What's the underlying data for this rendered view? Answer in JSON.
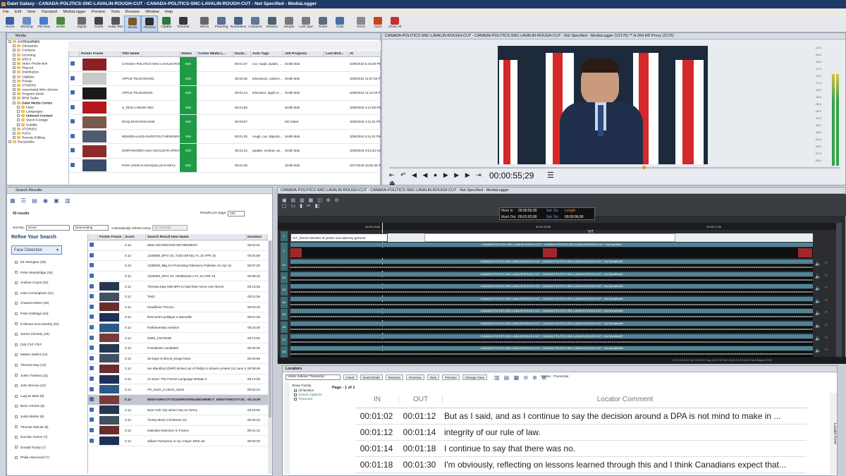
{
  "title": "Dalet Galaxy - CANADA-POLITICS-SNC-LAVALIN-ROUGH-CUT - CANADA-POLITICS-SNC-LAVALIN-ROUGH-CUT - Not Specified - MediaLogger",
  "menu": [
    "File",
    "Edit",
    "View",
    "Transport",
    "MediaLogger",
    "Preview",
    "Tools",
    "Browser",
    "Window",
    "Help"
  ],
  "toolbar": [
    {
      "label": "Home",
      "icon": "home-icon",
      "color": "#3b5ea8"
    },
    {
      "label": "Morning",
      "icon": "morning-icon",
      "color": "#6a8cc7"
    },
    {
      "label": "FB Area",
      "icon": "fb-area-icon",
      "color": "#4a7bc8"
    },
    {
      "label": "SoMe",
      "icon": "some-icon",
      "color": "#4b8a3d"
    },
    {
      "label": "Ingest",
      "icon": "ingest-icon",
      "color": "#6b6b6b"
    },
    {
      "label": "Crash",
      "icon": "crash-icon",
      "color": "#444"
    },
    {
      "label": "Audio Rec",
      "icon": "audio-rec-icon",
      "color": "#555"
    },
    {
      "label": "Media",
      "icon": "media-icon",
      "color": "#7c5a2c"
    },
    {
      "label": "Preview",
      "icon": "preview-icon",
      "color": "#303030"
    },
    {
      "label": "ClipBin",
      "icon": "clipbin-icon",
      "color": "#2b7a3e"
    },
    {
      "label": "Trimmer",
      "icon": "trimmer-icon",
      "color": "#393939"
    },
    {
      "label": "Wires",
      "icon": "wires-icon",
      "color": "#666"
    },
    {
      "label": "Planning",
      "icon": "planning-icon",
      "color": "#5a6f8f"
    },
    {
      "label": "Rundowns",
      "icon": "rundowns-icon",
      "color": "#4a5f80"
    },
    {
      "label": "Contacts",
      "icon": "contacts-icon",
      "color": "#5c7896"
    },
    {
      "label": "Monitor",
      "icon": "monitor-icon",
      "color": "#506070"
    },
    {
      "label": "Simple",
      "icon": "simple-icon",
      "color": "#777"
    },
    {
      "label": "Last Upd",
      "icon": "last-upd-icon",
      "color": "#7a7a7a"
    },
    {
      "label": "Ticker",
      "icon": "ticker-icon",
      "color": "#5d6d80"
    },
    {
      "label": "Chat",
      "icon": "chat-icon",
      "color": "#4a6fa5"
    },
    {
      "label": "OnAir",
      "icon": "onair-icon",
      "color": "#8a8a8a"
    },
    {
      "label": "Carts",
      "icon": "carts-icon",
      "color": "#c8431b"
    },
    {
      "label": "Close All",
      "icon": "close-all-icon",
      "color": "#c53030"
    }
  ],
  "media_panel": {
    "header": "Media",
    "tree": [
      {
        "t": "CATEGORIES",
        "lvl": 0,
        "b": true
      },
      {
        "t": "Glossaries",
        "lvl": 1
      },
      {
        "t": "Contacts",
        "lvl": 1
      },
      {
        "t": "Incoming",
        "lvl": 1
      },
      {
        "t": "NRCS",
        "lvl": 1
      },
      {
        "t": "Video Production",
        "lvl": 1
      },
      {
        "t": "Playout",
        "lvl": 1
      },
      {
        "t": "Distribution",
        "lvl": 1
      },
      {
        "t": "ClipBins",
        "lvl": 1
      },
      {
        "t": "Private",
        "lvl": 1
      },
      {
        "t": "OTHERS",
        "lvl": 1
      },
      {
        "t": "Associated Wire Stories",
        "lvl": 1
      },
      {
        "t": "Program MAM",
        "lvl": 1
      },
      {
        "t": "BPM Tasks",
        "lvl": 1
      },
      {
        "t": "Dalet Media Cortex",
        "lvl": 1,
        "b": true
      },
      {
        "t": "Input",
        "lvl": 2
      },
      {
        "t": "Languages",
        "lvl": 2
      },
      {
        "t": "Indexed Content",
        "lvl": 2,
        "b": true
      },
      {
        "t": "Stock Footage",
        "lvl": 2
      },
      {
        "t": "Subtitle",
        "lvl": 2
      },
      {
        "t": "STORIES",
        "lvl": 1
      },
      {
        "t": "POCs",
        "lvl": 1
      },
      {
        "t": "Remote Editing",
        "lvl": 1
      },
      {
        "t": "RecycleBin",
        "lvl": 0
      }
    ],
    "columns": [
      "",
      "Poster Frame",
      "Title Name",
      "Status",
      "Cortex Media L...",
      "Durat...",
      "Auto Tags",
      "Job Progress",
      "Last Mod...",
      "At"
    ],
    "rows": [
      {
        "title": "CANADA-POLITICS-SNC-LAVALIN-ROUGH-...",
        "status": "EMI",
        "dur": "00:01:37",
        "tags": "cut, rough, lavalin, ...",
        "by": "Smith Bob",
        "mod": "3/29/2019 5:43:38 PM"
      },
      {
        "title": "APPLE-TELEVISION1",
        "status": "EMI",
        "dur": "00:02:46",
        "tags": "television1, subscri...",
        "by": "Smith Bob",
        "mod": "3/28/2019 11:37:30 PM"
      },
      {
        "title": "APPLE-TELEVISION",
        "status": "EMI",
        "dur": "00:01:14",
        "tags": "television, apple tv ...",
        "by": "Smith Bob",
        "mod": "3/28/2019 11:14:03 PM"
      },
      {
        "title": "4_TESLA-MUSK-SEC",
        "status": "EMI",
        "dur": "00:01:56",
        "tags": "",
        "by": "Smith Bob",
        "mod": "3/28/2019 4:12:05 PM"
      },
      {
        "title": "IRAQ-IRAN-ROUHANI",
        "status": "EMI",
        "dur": "00:00:57",
        "tags": "",
        "by": "MC Dalet",
        "mod": "3/28/2019 4:11:31 PM"
      },
      {
        "title": "NEWZEALAND-SHOOTOUT-NEWSER-V...",
        "status": "EMI",
        "dur": "00:01:05",
        "tags": "rough, cut, objectio...",
        "by": "Smith Bob",
        "mod": "3/28/2019 4:11:01 PM"
      },
      {
        "title": "NORTHKOREA-USA-NUCLEAR-UPDATE",
        "status": "EMI",
        "dur": "00:01:22",
        "tags": "update, nuclear, us...",
        "by": "Smith Bob",
        "mod": "3/28/2019 4:01:34 AM"
      },
      {
        "title": "PAPA-JOHN-S-SHAQUILLE-O-NEAL",
        "status": "EMI",
        "dur": "00:01:28",
        "tags": "",
        "by": "Smith Bob",
        "mod": "3/27/2019 10:53:39 PM"
      }
    ]
  },
  "preview_panel": {
    "header": "CANADA-POLITICS-SNC-LAVALIN-ROUGH-CUT - CANADA-POLITICS-SNC-LAVALIN-ROUGH-CUT - Not Specified - MediaLogger (V2176) ** H.264 HD Proxy (2176)",
    "timecode": "00:00:55;29",
    "meter_labels": [
      "-12.0",
      "-15.0",
      "-18.0",
      "-21.0",
      "-24.0",
      "-27.0",
      "-30.0",
      "-33.0",
      "-36.0",
      "-39.0",
      "-42.0",
      "-45.0",
      "-48.0",
      "-51.0",
      "-54.0",
      "-57.0",
      "-60.0"
    ]
  },
  "search_panel": {
    "header": "Search Results",
    "count": "43 results",
    "results_per_page_label": "Results per page:",
    "results_per_page": "100",
    "sort_by_label": "Sort By:",
    "sort_by": "Score",
    "order": "Descending",
    "auto_refresh_label": "Automatically refresh every:",
    "auto_refresh": "30 seconds",
    "refine_label": "Refine Your Search",
    "facet": "Face Detection",
    "facets": [
      "Kit Harington (46)",
      "Peter Mansbridge (34)",
      "Andrew Coyne (32)",
      "Liam Cunningham (31)",
      "Chantal Hébert (28)",
      "Peter Dinklage (24)",
      "Krishnan Guru-Murthy (22)",
      "James Cleverly (18)",
      "יהודה חורין (16)",
      "Matteo Salvini (14)",
      "Theresa May (13)",
      "Justin Trudeau (11)",
      "John Bercow (10)",
      "Luigi Di Maio (9)",
      "Benz Antoine (8)",
      "Justin Bieber (8)",
      "Thomas Mulcair (8)",
      "Dominic Grieve (7)",
      "Donald Trump (7)",
      "Philip Hammond (7)"
    ],
    "columns": [
      "",
      "Poster Frame",
      "Score",
      "Search Result Item Name",
      "Duration"
    ],
    "rows": [
      {
        "score": "0.12",
        "name": "MMA-MCGREGOR-RETIREMENT",
        "dur": "00:02:01",
        "thumb": false
      },
      {
        "score": "0.12",
        "name": "1335009_MTG SC 7248 ISRAEL FL 15 APR 15",
        "dur": "00:04:59",
        "thumb": false
      },
      {
        "score": "0.12",
        "name": "1338528_Mtg GA Promoting Tolerance Pakistan 21 Apr 15",
        "dur": "00:07:20",
        "thumb": false
      },
      {
        "score": "0.12",
        "name": "1335006_MTG SC VENEZUELA FL 15 APR 15",
        "dur": "00:08:16",
        "thumb": false
      },
      {
        "score": "0.12",
        "name": "Theresa May tells MPs to hold their nerve over Brexit",
        "dur": "00:13:38",
        "thumb": true
      },
      {
        "score": "0.12",
        "name": "Test2",
        "dur": "00:01:36",
        "thumb": true
      },
      {
        "score": "0.12",
        "name": "Headlines TGCom",
        "dur": "00:03:40",
        "thumb": true
      },
      {
        "score": "0.12",
        "name": "Rencontre politique a Marseille",
        "dur": "00:01:28",
        "thumb": true
      },
      {
        "score": "0.12",
        "name": "Parliamentary session",
        "dur": "00:33:48",
        "thumb": true
      },
      {
        "score": "0.12",
        "name": "RMM_10370535",
        "dur": "00:13:02",
        "thumb": true
      },
      {
        "score": "0.12",
        "name": "Presidente Candidato",
        "dur": "00:20:46",
        "thumb": true
      },
      {
        "score": "0.12",
        "name": "25 Days to Brexit_Drugs fears",
        "dur": "00:02:59",
        "thumb": true
      },
      {
        "score": "0.12",
        "name": "Ian Blackford (SNP) kicked out of PMQs in bizarre protest (13 June 2...",
        "dur": "00:08:49",
        "thumb": true
      },
      {
        "score": "0.12",
        "name": "At Issue: The French-Language Debate 2",
        "dur": "00:14:35",
        "thumb": true
      },
      {
        "score": "0.12",
        "name": "FR_news_2-24min_same",
        "dur": "00:02:24",
        "thumb": true
      },
      {
        "score": "0.12",
        "name": "NEWYORKCITY2018WINTERbadWOMERCY_NEWYORKCITY20...",
        "dur": "00:15:00",
        "thumb": true,
        "sel": true
      },
      {
        "score": "0.12",
        "name": "New York City winter has no mercy",
        "dur": "00:15:00",
        "thumb": true
      },
      {
        "score": "0.12",
        "name": "Trump Merry Christmas VO",
        "dur": "00:00:10",
        "thumb": true
      },
      {
        "score": "0.12",
        "name": "Islamists Detection in France",
        "dur": "00:01:12",
        "thumb": true
      },
      {
        "score": "0.12",
        "name": "william thompson sr nyc mayor 2002 sot",
        "dur": "00:00:20",
        "thumb": true
      }
    ]
  },
  "logger_panel": {
    "header": "CANADA-POLITICS-SNC-LAVALIN-ROUGH-CUT - CANADA-POLITICS-SNC-LAVALIN-ROUGH-CUT - Not Specified - MediaLogger",
    "mark_in_label": "Mark In",
    "mark_in": "00:00:55;29",
    "mark_out_label": "Mark Out",
    "mark_out": "00:01:02;00",
    "length_label": "Length",
    "length": "00:00:06;00",
    "set_label": "Set",
    "go_label": "Go",
    "ruler": [
      "00:00:15;00",
      "00:00:16;00",
      "00:00:17;00"
    ],
    "vit_label": "VIT",
    "title_bar_text": "VIT_former Minister of justice and attorney general",
    "clip_name": "CANADA-POLITICS-SNC-LAVALIN-ROUGH-CUT - CANADA-POLITICS-SNC-LAVALIN-ROUGH-CUT - Not Specified",
    "audio_tracks": [
      "A1",
      "A2",
      "A3",
      "A4",
      "A5",
      "A6",
      "A7",
      "A8"
    ],
    "audio_suffix": [
      "#1",
      "#2",
      "#3",
      "#4",
      "#5",
      "#6",
      "#7",
      "#8"
    ],
    "status": "V/O: 00:15:22   Tot: 00:02:22   Seg: 00:37:02   Sel: 00:01:21   00:00:51   Non-Ripple   NTSC"
  },
  "locators": {
    "header": "Locators",
    "mode": "Video Indexer Transcript",
    "buttons": [
      "Insert",
      "Insert Mode",
      "Remove",
      "Previous",
      "Next",
      "Preview",
      "Change View"
    ],
    "source": "Cortex - Transcript",
    "show_family": "Show Family",
    "families": [
      "All families",
      "Closed Captions",
      "Transcript"
    ],
    "page": "Page - 1 of 1",
    "side_label": "Locator Form",
    "columns": [
      "IN",
      "OUT",
      "Locator Comment"
    ],
    "rows": [
      {
        "in": "00:01:02",
        "out": "00:01:12",
        "comment": "But as I said, and as I continue to say the decision around a DPA is not mind to make in ..."
      },
      {
        "in": "00:01:12",
        "out": "00:01:14",
        "comment": "integrity of our rule of law."
      },
      {
        "in": "00:01:14",
        "out": "00:01:18",
        "comment": "I continue to say that there was no."
      },
      {
        "in": "00:01:18",
        "out": "00:01:30",
        "comment": "I'm obviously, reflecting on lessons learned through this and I think Canadians expect that..."
      }
    ]
  }
}
